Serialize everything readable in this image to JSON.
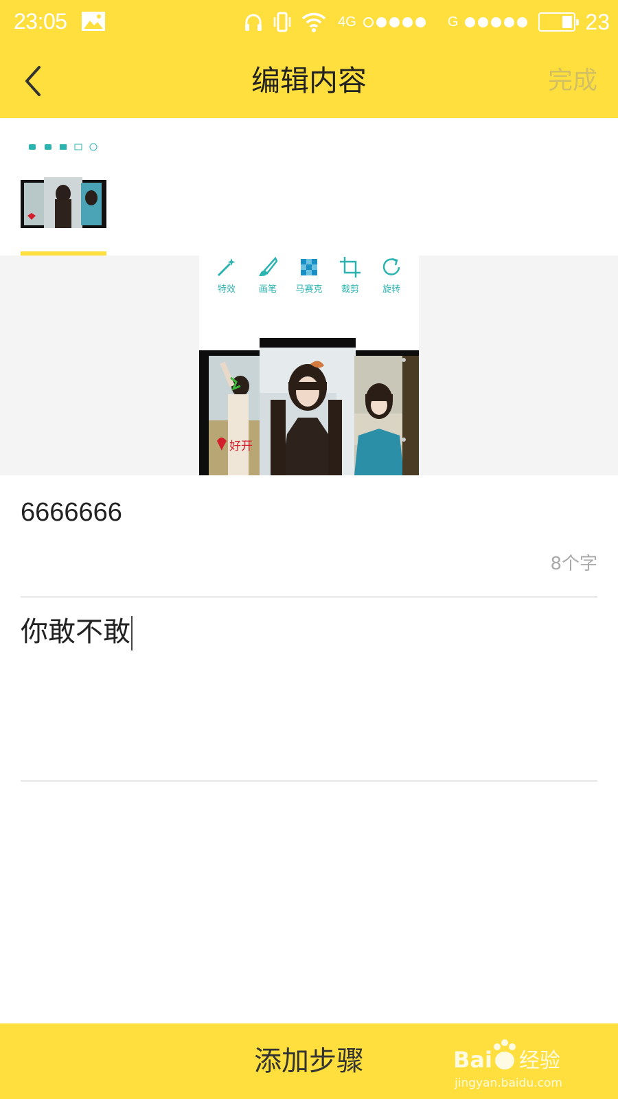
{
  "status_bar": {
    "time": "23:05",
    "network_1": "4G",
    "network_2": "G",
    "battery_level": "23"
  },
  "nav": {
    "title": "编辑内容",
    "done_label": "完成"
  },
  "thumbnails": [
    {
      "selected": true
    }
  ],
  "preview": {
    "tools": [
      {
        "label": "特效",
        "icon": "magic-wand-icon"
      },
      {
        "label": "画笔",
        "icon": "brush-icon"
      },
      {
        "label": "马赛克",
        "icon": "mosaic-icon"
      },
      {
        "label": "裁剪",
        "icon": "crop-icon"
      },
      {
        "label": "旋转",
        "icon": "rotate-icon"
      }
    ],
    "collage_text": "好开"
  },
  "form": {
    "title_value": "6666666",
    "char_count": "8个字",
    "body_value": "你敢不敢"
  },
  "bottom": {
    "add_step_label": "添加步骤",
    "watermark_brand": "Bai",
    "watermark_brand_2": "经验",
    "watermark_url": "jingyan.baidu.com"
  },
  "colors": {
    "accent": "#ffdf3d",
    "tool_teal": "#2bb3b0"
  }
}
